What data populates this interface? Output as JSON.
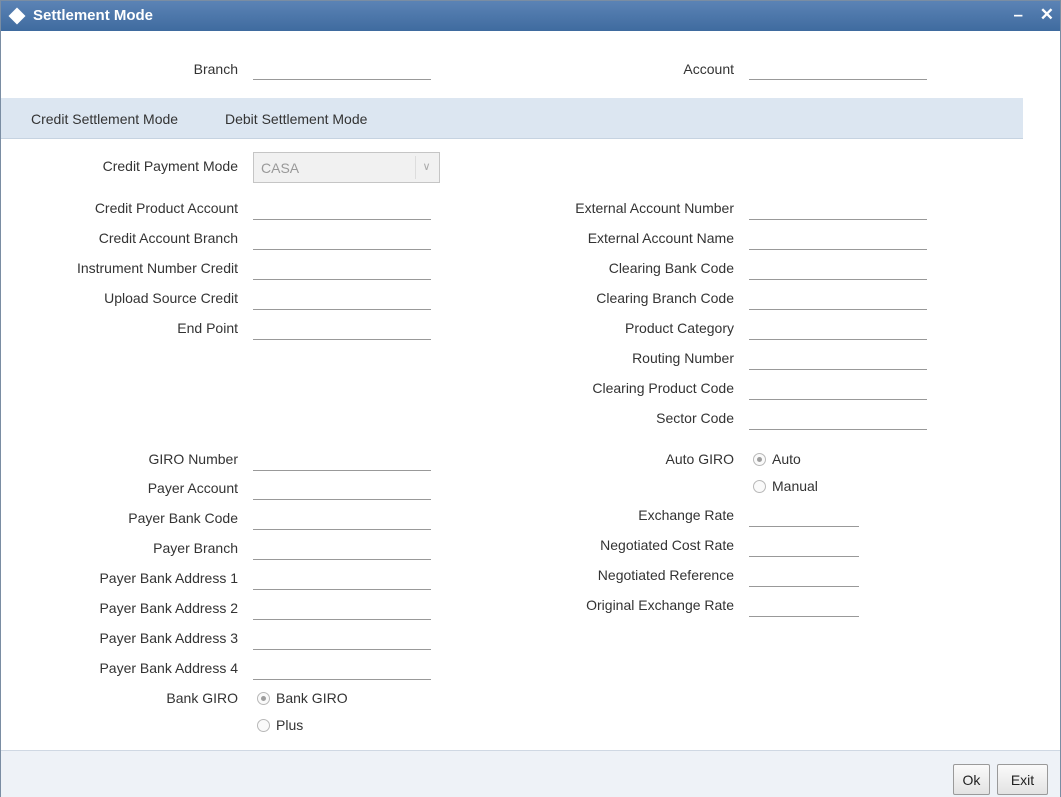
{
  "window": {
    "title": "Settlement Mode",
    "minimize_glyph": "–",
    "close_glyph": "✕"
  },
  "header": {
    "branch_label": "Branch",
    "branch_value": "",
    "account_label": "Account",
    "account_value": ""
  },
  "tabs": [
    {
      "label": "Credit Settlement Mode",
      "active": true
    },
    {
      "label": "Debit Settlement Mode",
      "active": false
    }
  ],
  "credit": {
    "payment_mode_label": "Credit Payment Mode",
    "payment_mode_value": "CASA",
    "left_fields": [
      {
        "label": "Credit Product Account",
        "value": ""
      },
      {
        "label": "Credit Account Branch",
        "value": ""
      },
      {
        "label": "Instrument Number Credit",
        "value": ""
      },
      {
        "label": "Upload Source Credit",
        "value": ""
      },
      {
        "label": "End Point",
        "value": ""
      }
    ],
    "right_fields": [
      {
        "label": "External Account Number",
        "value": ""
      },
      {
        "label": "External Account Name",
        "value": ""
      },
      {
        "label": "Clearing Bank Code",
        "value": ""
      },
      {
        "label": "Clearing Branch Code",
        "value": ""
      },
      {
        "label": "Product Category",
        "value": ""
      },
      {
        "label": "Routing Number",
        "value": ""
      },
      {
        "label": "Clearing Product Code",
        "value": ""
      },
      {
        "label": "Sector Code",
        "value": ""
      }
    ]
  },
  "giro": {
    "left_fields": [
      {
        "label": "GIRO Number",
        "value": ""
      },
      {
        "label": "Payer Account",
        "value": ""
      },
      {
        "label": "Payer Bank Code",
        "value": ""
      },
      {
        "label": "Payer Branch",
        "value": ""
      },
      {
        "label": "Payer Bank Address 1",
        "value": ""
      },
      {
        "label": "Payer Bank Address 2",
        "value": ""
      },
      {
        "label": "Payer Bank Address 3",
        "value": ""
      },
      {
        "label": "Payer Bank Address 4",
        "value": ""
      }
    ],
    "bank_giro_label": "Bank GIRO",
    "bank_giro_options": [
      {
        "label": "Bank GIRO",
        "checked": true
      },
      {
        "label": "Plus",
        "checked": false
      }
    ],
    "auto_giro_label": "Auto GIRO",
    "auto_giro_options": [
      {
        "label": "Auto",
        "checked": true
      },
      {
        "label": "Manual",
        "checked": false
      }
    ],
    "right_fields": [
      {
        "label": "Exchange Rate",
        "value": ""
      },
      {
        "label": "Negotiated Cost Rate",
        "value": ""
      },
      {
        "label": "Negotiated Reference",
        "value": ""
      },
      {
        "label": "Original Exchange Rate",
        "value": ""
      }
    ]
  },
  "footer": {
    "ok_label": "Ok",
    "exit_label": "Exit"
  }
}
